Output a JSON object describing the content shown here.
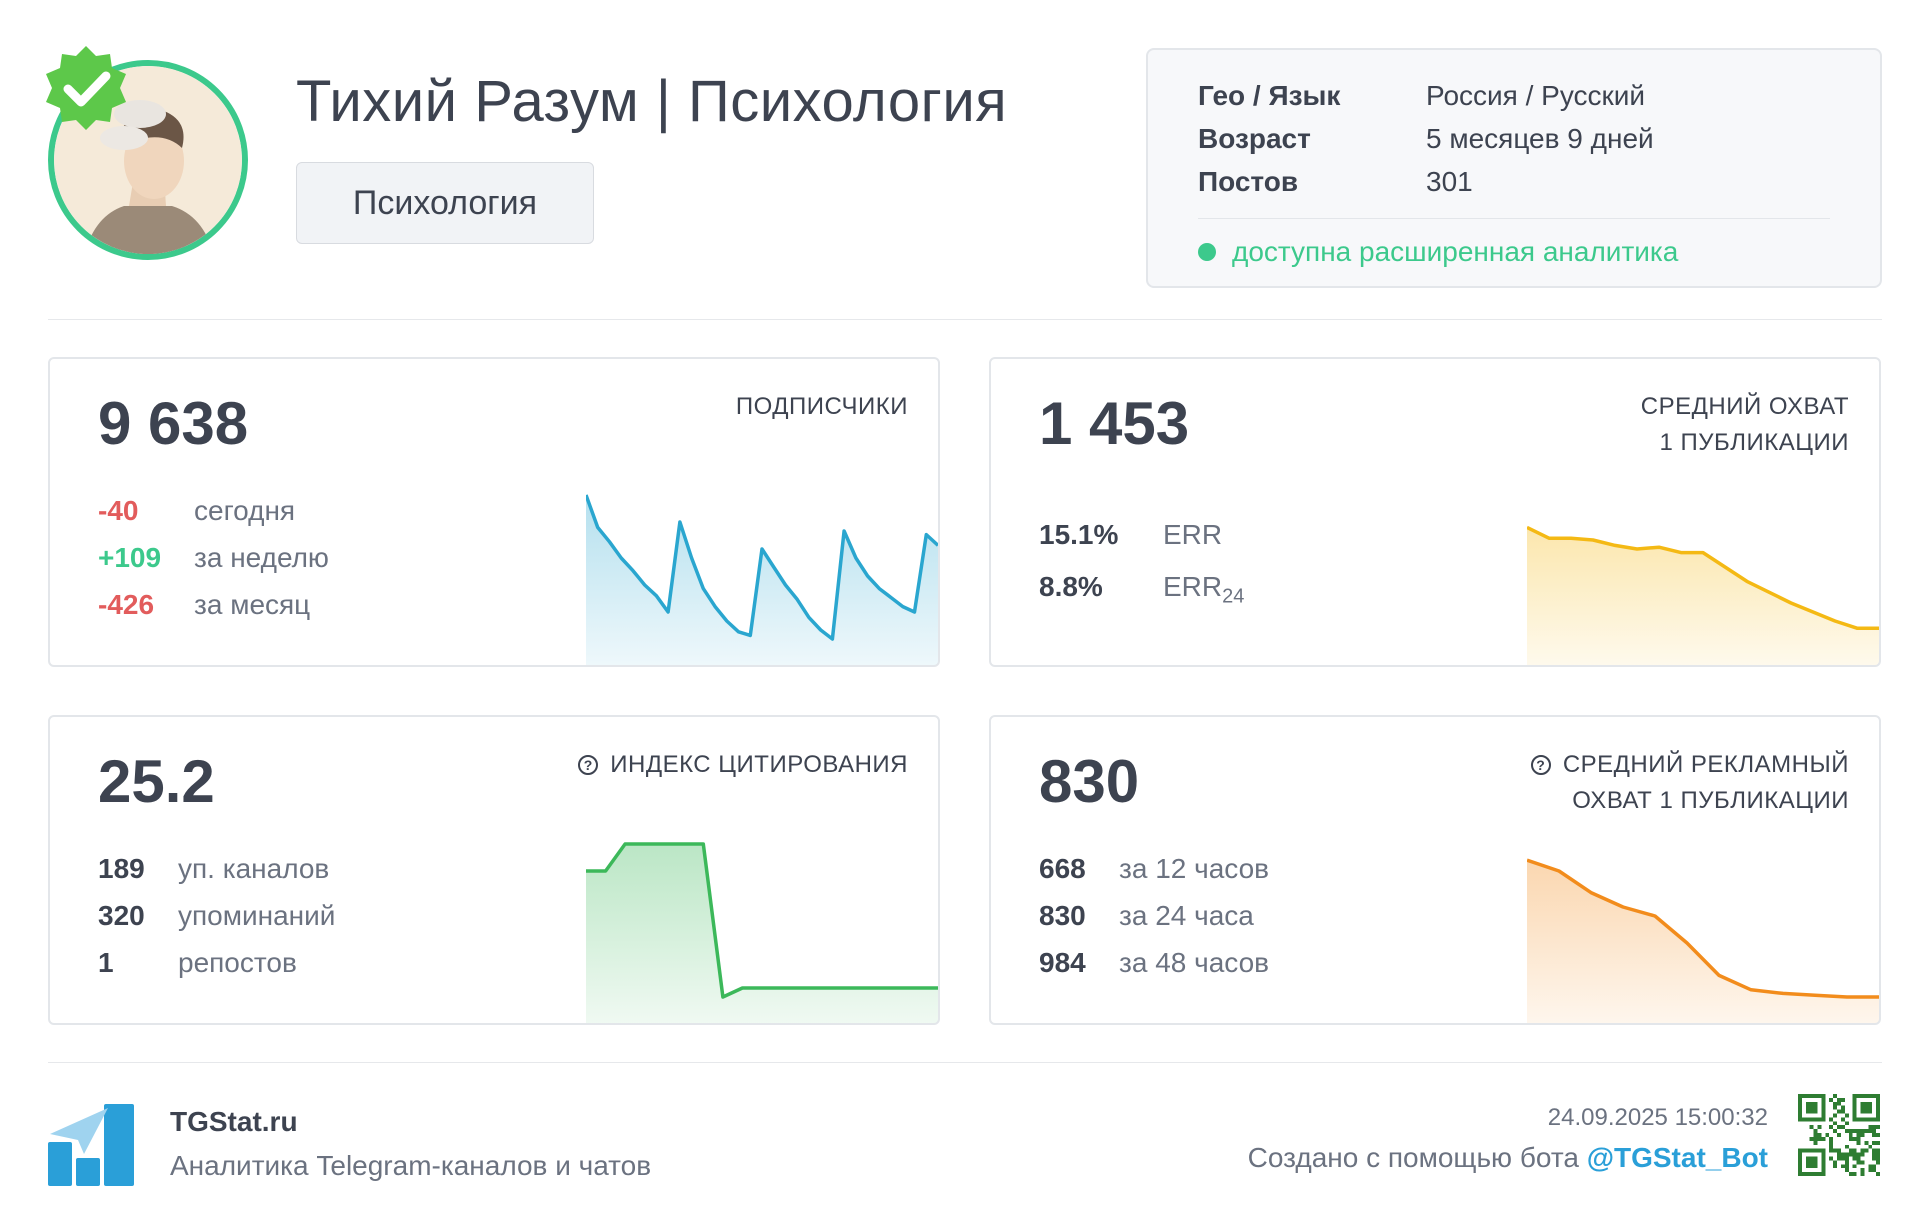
{
  "header": {
    "title": "Тихий Разум | Психология",
    "category": "Психология"
  },
  "info": {
    "rows": [
      {
        "key": "Гео / Язык",
        "value": "Россия / Русский"
      },
      {
        "key": "Возраст",
        "value": "5 месяцев 9 дней"
      },
      {
        "key": "Постов",
        "value": "301"
      }
    ],
    "analytics_note": "доступна расширенная аналитика"
  },
  "cards": {
    "subscribers": {
      "value": "9 638",
      "label": "ПОДПИСЧИКИ",
      "rows": [
        {
          "num": "-40",
          "text": "сегодня"
        },
        {
          "num": "+109",
          "text": "за неделю"
        },
        {
          "num": "-426",
          "text": "за месяц"
        }
      ],
      "chart_color": "#2aa6cf",
      "chart_series": [
        0.9,
        0.72,
        0.64,
        0.55,
        0.48,
        0.4,
        0.34,
        0.25,
        0.75,
        0.55,
        0.38,
        0.28,
        0.2,
        0.14,
        0.12,
        0.6,
        0.5,
        0.4,
        0.32,
        0.22,
        0.15,
        0.1,
        0.7,
        0.55,
        0.45,
        0.38,
        0.33,
        0.28,
        0.25,
        0.68,
        0.62
      ]
    },
    "reach": {
      "value": "1 453",
      "label_line1": "СРЕДНИЙ ОХВАТ",
      "label_line2": "1 ПУБЛИКАЦИИ",
      "rows": [
        {
          "num": "15.1%",
          "text": "ERR",
          "sub": ""
        },
        {
          "num": "8.8%",
          "text": "ERR",
          "sub": "24"
        }
      ],
      "chart_color": "#f4b914",
      "chart_series": [
        0.72,
        0.66,
        0.66,
        0.65,
        0.62,
        0.6,
        0.61,
        0.58,
        0.58,
        0.5,
        0.42,
        0.36,
        0.3,
        0.25,
        0.2,
        0.16,
        0.16
      ]
    },
    "citation": {
      "value": "25.2",
      "label": "ИНДЕКС ЦИТИРОВАНИЯ",
      "rows": [
        {
          "num": "189",
          "text": "уп. каналов"
        },
        {
          "num": "320",
          "text": "упоминаний"
        },
        {
          "num": "1",
          "text": "репостов"
        }
      ],
      "chart_color": "#3cb85a",
      "chart_series": [
        0.8,
        0.8,
        0.95,
        0.95,
        0.95,
        0.95,
        0.95,
        0.1,
        0.15,
        0.15,
        0.15,
        0.15,
        0.15,
        0.15,
        0.15,
        0.15,
        0.15,
        0.15,
        0.15
      ]
    },
    "ad_reach": {
      "value": "830",
      "label_line1": "СРЕДНИЙ РЕКЛАМНЫЙ",
      "label_line2": "ОХВАТ 1 ПУБЛИКАЦИИ",
      "rows": [
        {
          "num": "668",
          "text": "за 12 часов"
        },
        {
          "num": "830",
          "text": "за 24 часа"
        },
        {
          "num": "984",
          "text": "за 48 часов"
        }
      ],
      "chart_color": "#f28c1c",
      "chart_series": [
        0.86,
        0.8,
        0.68,
        0.6,
        0.55,
        0.4,
        0.22,
        0.14,
        0.12,
        0.11,
        0.1,
        0.1
      ]
    }
  },
  "footer": {
    "brand": "TGStat.ru",
    "description": "Аналитика Telegram-каналов и чатов",
    "timestamp": "24.09.2025 15:00:32",
    "created_prefix": "Создано с помощью бота ",
    "bot": "@TGStat_Bot"
  },
  "colors": {
    "accent_green": "#3cc98c",
    "negative_red": "#e25c5c",
    "link_blue": "#2a9fd8"
  },
  "icons": [
    "verified-badge-icon",
    "help-icon",
    "tgstat-logo-icon",
    "qr-code-icon"
  ]
}
